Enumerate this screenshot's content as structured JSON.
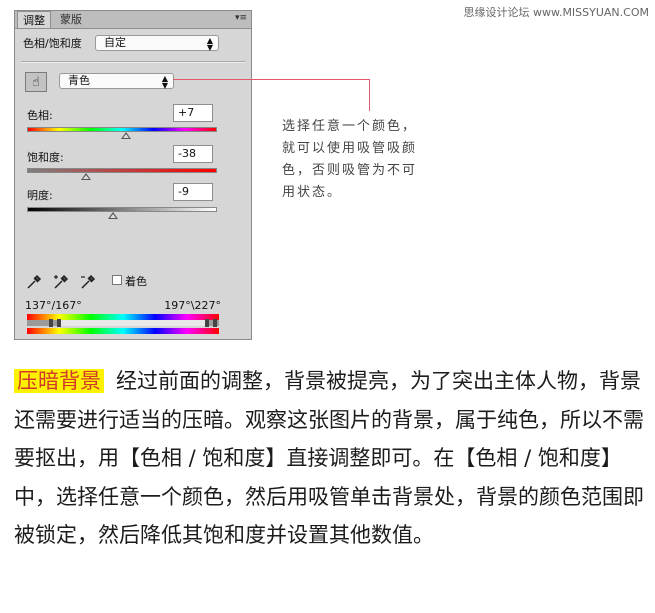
{
  "watermark": "思缘设计论坛 www.MISSYUAN.COM",
  "panel": {
    "tabs": [
      "调整",
      "蒙版"
    ],
    "menu_icon": "panel-menu-icon",
    "preset_label": "色相/饱和度",
    "preset_value": "自定",
    "channel_value": "青色",
    "hue_label": "色相:",
    "hue_value": "+7",
    "hue_fraction": 0.52,
    "saturation_label": "饱和度:",
    "saturation_value": "-38",
    "saturation_fraction": 0.31,
    "lightness_label": "明度:",
    "lightness_value": "-9",
    "lightness_fraction": 0.45,
    "colorize_label": "着色",
    "range_left": "137°/167°",
    "range_right": "197°\\227°"
  },
  "annotation": {
    "color": "#e05a6a",
    "lines": [
      "选择任意一个颜色，",
      "就可以使用吸管吸颜",
      "色，否则吸管为不可",
      "用状态。"
    ]
  },
  "article": {
    "highlight_color": "#fff200",
    "highlight_text_color": "#d0392b",
    "heading": "压暗背景",
    "body": "经过前面的调整，背景被提亮，为了突出主体人物，背景还需要进行适当的压暗。观察这张图片的背景，属于纯色，所以不需要抠出，用【色相 / 饱和度】直接调整即可。在【色相 / 饱和度】中，选择任意一个颜色，然后用吸管单击背景处，背景的颜色范围即被锁定，然后降低其饱和度并设置其他数值。"
  }
}
